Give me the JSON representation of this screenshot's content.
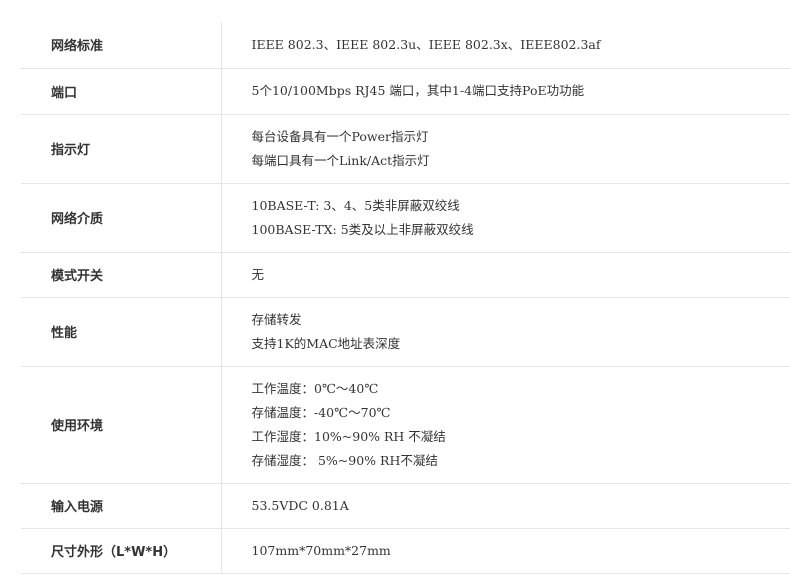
{
  "specs": [
    {
      "label": "网络标准",
      "lines": [
        "IEEE 802.3、IEEE 802.3u、IEEE 802.3x、IEEE802.3af"
      ]
    },
    {
      "label": "端口",
      "lines": [
        "5个10/100Mbps RJ45 端口，其中1-4端口支持PoE功功能"
      ]
    },
    {
      "label": "指示灯",
      "lines": [
        "每台设备具有一个Power指示灯",
        "每端口具有一个Link/Act指示灯"
      ]
    },
    {
      "label": "网络介质",
      "lines": [
        "10BASE-T: 3、4、5类非屏蔽双绞线",
        "100BASE-TX: 5类及以上非屏蔽双绞线"
      ]
    },
    {
      "label": "模式开关",
      "lines": [
        "无"
      ]
    },
    {
      "label": "性能",
      "lines": [
        "存储转发",
        "支持1K的MAC地址表深度"
      ]
    },
    {
      "label": "使用环境",
      "lines": [
        "工作温度：0℃～40℃",
        "存储温度：-40℃～70℃",
        "工作湿度：10%~90% RH 不凝结",
        "存储湿度： 5%~90% RH不凝结"
      ]
    },
    {
      "label": "输入电源",
      "lines": [
        "53.5VDC 0.81A"
      ]
    },
    {
      "label": "尺寸外形（L*W*H）",
      "lines": [
        "107mm*70mm*27mm"
      ]
    }
  ]
}
